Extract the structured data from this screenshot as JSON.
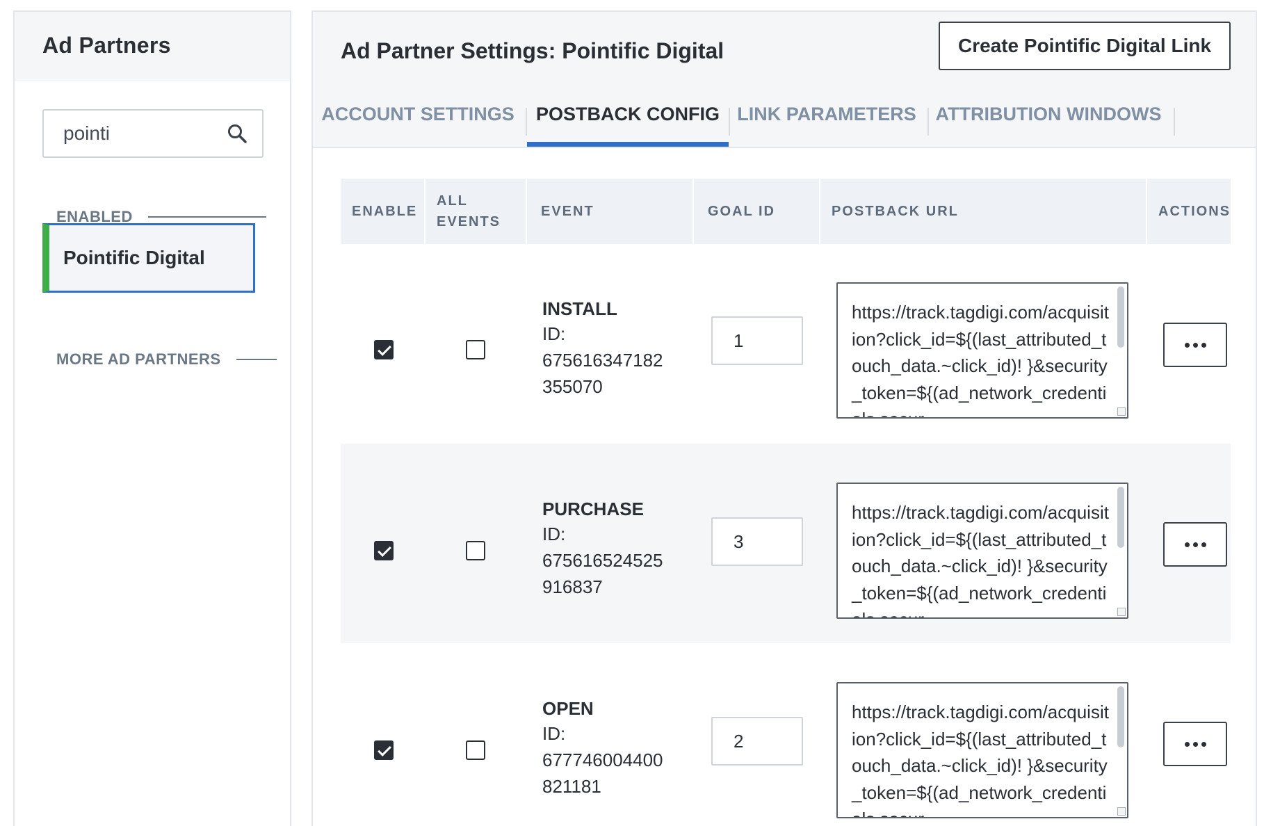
{
  "sidebar": {
    "title": "Ad Partners",
    "search": {
      "value": "pointi",
      "placeholder": ""
    },
    "enabled_label": "ENABLED",
    "enabled_items": [
      {
        "label": "Pointific Digital",
        "status_color": "#3fae49"
      }
    ],
    "more_label": "MORE AD PARTNERS"
  },
  "header": {
    "title": "Ad Partner Settings: Pointific Digital",
    "create_button_label": "Create Pointific Digital Link"
  },
  "tabs": [
    {
      "label": "ACCOUNT SETTINGS",
      "active": false
    },
    {
      "label": "POSTBACK CONFIG",
      "active": true
    },
    {
      "label": "LINK PARAMETERS",
      "active": false
    },
    {
      "label": "ATTRIBUTION WINDOWS",
      "active": false
    }
  ],
  "table": {
    "headers": {
      "enable": "ENABLE",
      "all_events_line1": "ALL",
      "all_events_line2": "EVENTS",
      "event": "EVENT",
      "goal_id": "GOAL ID",
      "postback_url": "POSTBACK URL",
      "actions": "ACTIONS"
    },
    "rows": [
      {
        "event": "INSTALL",
        "id_label": "ID:",
        "id_value": "675616347182355070",
        "enabled": true,
        "all_events": false,
        "goal_id": "1",
        "postback_url": "https://track.tagdigi.com/acquisition?click_id=${(last_attributed_touch_data.~click_id)! }&security_token=${(ad_network_credentials.secur"
      },
      {
        "event": "PURCHASE",
        "id_label": "ID:",
        "id_value": "675616524525916837",
        "enabled": true,
        "all_events": false,
        "goal_id": "3",
        "postback_url": "https://track.tagdigi.com/acquisition?click_id=${(last_attributed_touch_data.~click_id)! }&security_token=${(ad_network_credentials.secur"
      },
      {
        "event": "OPEN",
        "id_label": "ID:",
        "id_value": "677746004400821181",
        "enabled": true,
        "all_events": false,
        "goal_id": "2",
        "postback_url": "https://track.tagdigi.com/acquisition?click_id=${(last_attributed_touch_data.~click_id)! }&security_token=${(ad_network_credentials.secur"
      }
    ]
  },
  "colors": {
    "accent_blue": "#2f6fc7",
    "enabled_green": "#3fae49",
    "header_bg": "#f5f6f8",
    "table_header_bg": "#eef1f5"
  }
}
